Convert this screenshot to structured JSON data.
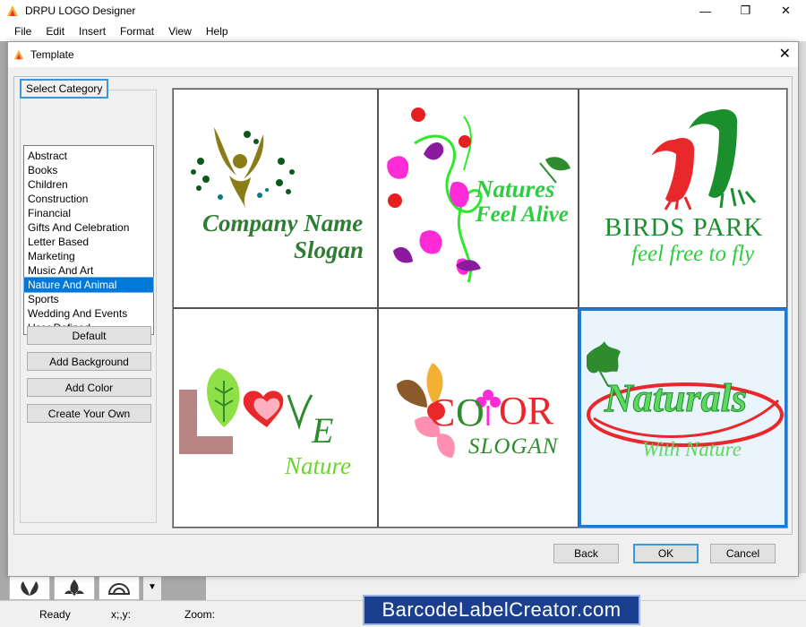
{
  "app": {
    "title": "DRPU LOGO Designer",
    "menu": [
      "File",
      "Edit",
      "Insert",
      "Format",
      "View",
      "Help"
    ]
  },
  "dialog": {
    "title": "Template",
    "category_label": "Select Category",
    "categories": [
      "Abstract",
      "Books",
      "Children",
      "Construction",
      "Financial",
      "Gifts And Celebration",
      "Letter Based",
      "Marketing",
      "Music And Art",
      "Nature And Animal",
      "Sports",
      "Wedding And Events",
      "User Defined"
    ],
    "selected_category": "Nature And Animal",
    "side_buttons": {
      "default": "Default",
      "add_background": "Add Background",
      "add_color": "Add Color",
      "create_your_own": "Create Your Own"
    },
    "templates": [
      {
        "line1": "Company Name",
        "line2": "Slogan"
      },
      {
        "line1": "Natures",
        "line2": "Feel Alive"
      },
      {
        "line1": "BIRDS PARK",
        "line2": "feel free to fly"
      },
      {
        "line1": "VE",
        "line2": "Nature"
      },
      {
        "line1": "OR",
        "line2": "SLOGAN"
      },
      {
        "line1": "Naturals",
        "line2": "With Nature"
      }
    ],
    "selected_template": 5,
    "footer": {
      "back": "Back",
      "ok": "OK",
      "cancel": "Cancel"
    }
  },
  "status": {
    "ready": "Ready",
    "xy": "x;,y:",
    "zoom": "Zoom:"
  },
  "watermark": "BarcodeLabelCreator.com",
  "colors": {
    "accent": "#0078d7",
    "green": "#2e8b2e",
    "red": "#e8282a",
    "magenta": "#ff2bd6",
    "purple": "#8b1b9e"
  }
}
